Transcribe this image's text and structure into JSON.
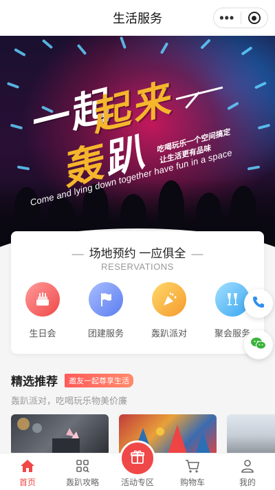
{
  "topbar": {
    "title": "生活服务"
  },
  "banner": {
    "line1_white": "一起",
    "line1_yellow": "起来",
    "line2_yellow": "轰",
    "line2_white": "趴",
    "slogan_1": "吃喝玩乐一个空间搞定",
    "slogan_2": "让生活更有品味",
    "english": "Come and lying down together have fun in a space"
  },
  "reservations": {
    "title": "场地预约 一应俱全",
    "dash": "—",
    "subtitle": "RESERVATIONS",
    "items": [
      {
        "label": "生日会",
        "icon": "cake-icon",
        "color_from": "#ff8a8a",
        "color_to": "#f04848"
      },
      {
        "label": "团建服务",
        "icon": "flag-icon",
        "color_from": "#9db4ff",
        "color_to": "#5b7df0"
      },
      {
        "label": "轰趴派对",
        "icon": "party-popper-icon",
        "color_from": "#ffd36b",
        "color_to": "#f59a2c"
      },
      {
        "label": "聚会服务",
        "icon": "glasses-icon",
        "color_from": "#8fd8ff",
        "color_to": "#3aa6f0"
      }
    ]
  },
  "floating": {
    "phone": "phone-icon",
    "wechat": "wechat-icon"
  },
  "recommend": {
    "title": "精选推荐",
    "tag": "邀友一起尊享生活",
    "desc": "轰趴派对，吃喝玩乐物美价廉"
  },
  "tabbar": {
    "tabs": [
      {
        "label": "首页",
        "active": true
      },
      {
        "label": "轰趴攻略",
        "active": false
      },
      {
        "label": "活动专区",
        "active": false
      },
      {
        "label": "购物车",
        "active": false
      },
      {
        "label": "我的",
        "active": false
      }
    ]
  },
  "colors": {
    "accent": "#f04848",
    "tag_from": "#ff5a5a",
    "tag_to": "#ff8a6b"
  }
}
